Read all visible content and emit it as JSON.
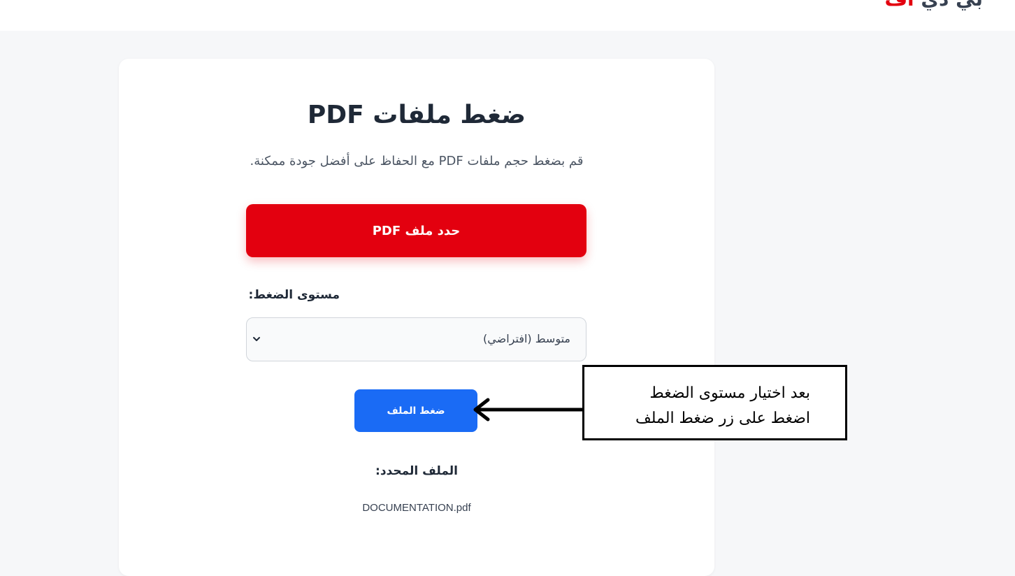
{
  "header": {
    "logo_part1": "بي دي",
    "logo_part2": "اف"
  },
  "tool": {
    "title": "ضغط ملفات PDF",
    "subtitle": "قم بضغط حجم ملفات PDF مع الحفاظ على أفضل جودة ممكنة.",
    "select_file_label": "حدد ملف PDF",
    "compression_level_label": "مستوى الضغط:",
    "compression_level_value": "متوسط (افتراضي)",
    "compress_button_label": "ضغط الملف",
    "selected_file_label": "الملف المحدد:",
    "selected_file_name": "DOCUMENTATION.pdf"
  },
  "annotation": {
    "line1": "بعد اختيار مستوى الضغط",
    "line2": "اضغط على زر ضغط الملف"
  },
  "colors": {
    "brand_red": "#e3000f",
    "action_blue": "#1a6bf5"
  },
  "icons": {
    "select_chevron": "chevron-down-icon",
    "annotation_arrow": "arrow-left-icon"
  }
}
